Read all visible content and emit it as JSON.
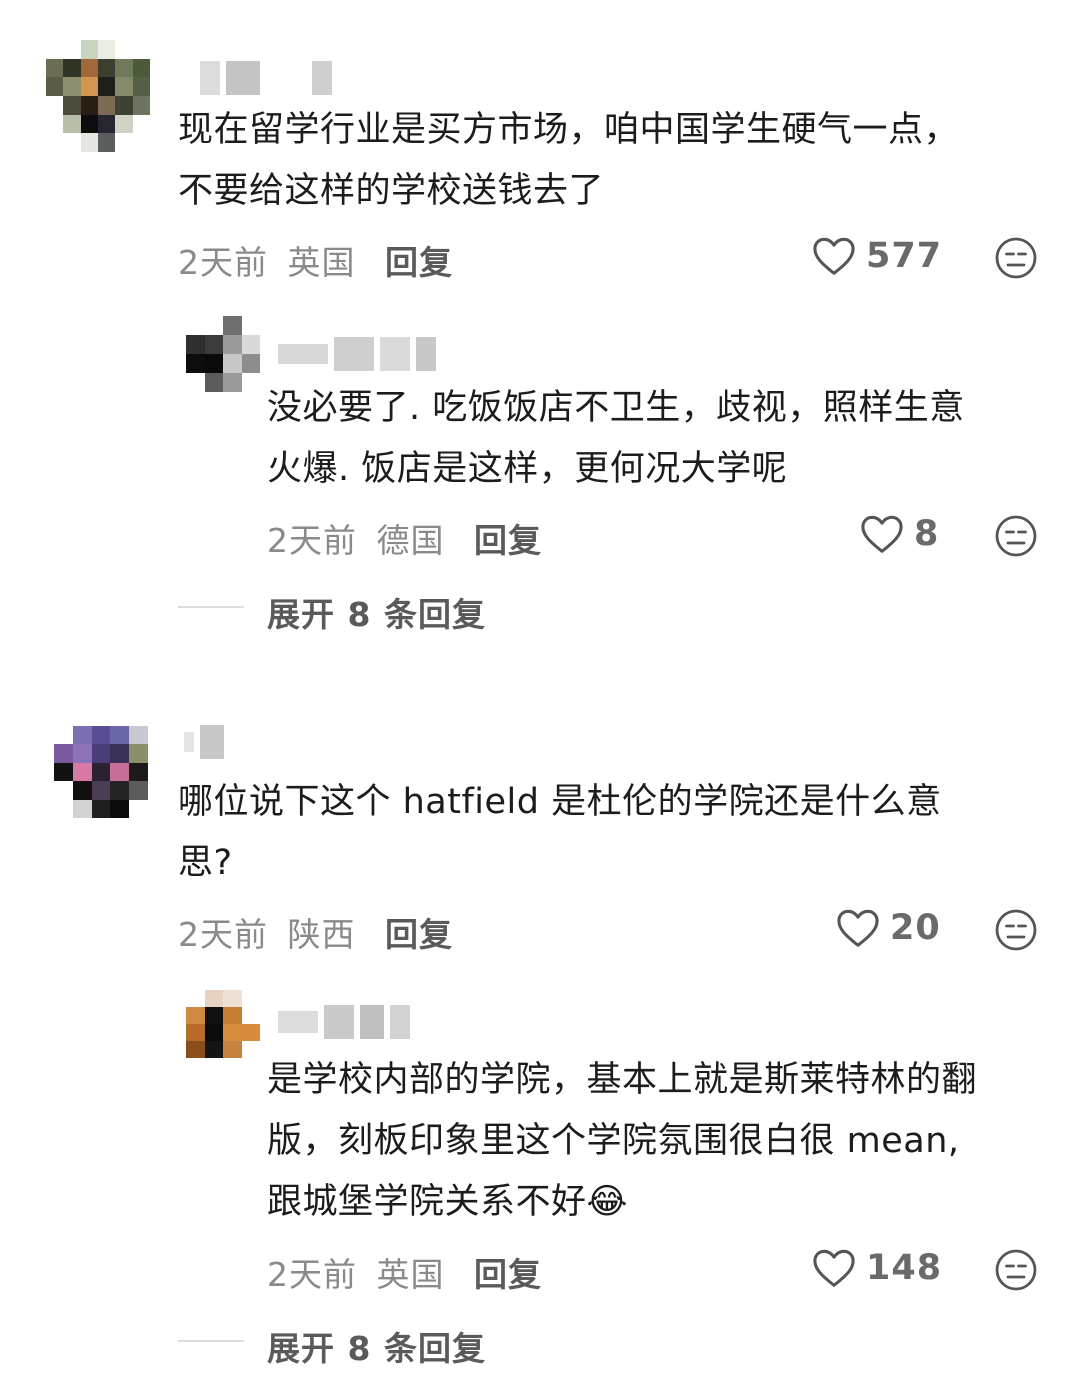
{
  "comments": [
    {
      "text_lines": [
        "现在留学行业是买方市场，咱中国学生硬气一点，",
        "不要给这样的学校送钱去了"
      ],
      "time": "2天前",
      "location": "英国",
      "reply_label": "回复",
      "likes": "577",
      "replies": [
        {
          "text_lines": [
            "没必要了. 吃饭饭店不卫生，歧视，照样生意",
            "火爆. 饭店是这样，更何况大学呢"
          ],
          "time": "2天前",
          "location": "德国",
          "reply_label": "回复",
          "likes": "8"
        }
      ],
      "expand_label": "展开 8 条回复"
    },
    {
      "text_lines": [
        "哪位说下这个 hatfield 是杜伦的学院还是什么意",
        "思?"
      ],
      "time": "2天前",
      "location": "陕西",
      "reply_label": "回复",
      "likes": "20",
      "replies": [
        {
          "text_lines": [
            "是学校内部的学院，基本上就是斯莱特林的翻",
            "版，刻板印象里这个学院氛围很白很 mean,",
            "跟城堡学院关系不好😂"
          ],
          "time": "2天前",
          "location": "英国",
          "reply_label": "回复",
          "likes": "148"
        }
      ],
      "expand_label": "展开 8 条回复"
    }
  ],
  "icons": {
    "like": "heart-outline-icon",
    "dislike": "neutral-face-icon"
  },
  "colors": {
    "text": "#1c1c1c",
    "meta": "#8a8a8a",
    "icon": "#555555"
  }
}
